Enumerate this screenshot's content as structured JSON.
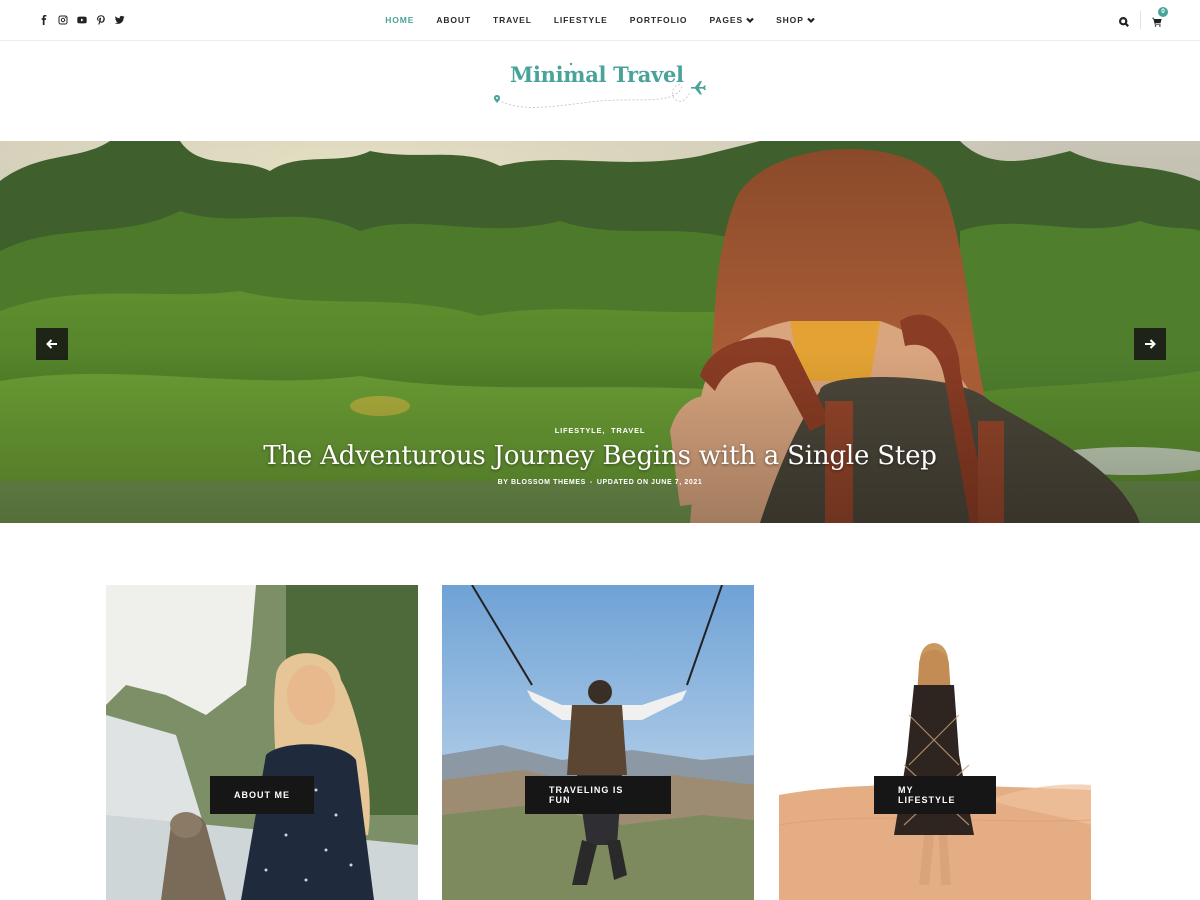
{
  "social": {
    "icons": [
      "facebook-icon",
      "instagram-icon",
      "youtube-icon",
      "pinterest-icon",
      "twitter-icon"
    ]
  },
  "nav": {
    "items": [
      {
        "label": "HOME",
        "active": true
      },
      {
        "label": "ABOUT"
      },
      {
        "label": "TRAVEL"
      },
      {
        "label": "LIFESTYLE"
      },
      {
        "label": "PORTFOLIO"
      },
      {
        "label": "PAGES",
        "dropdown": true
      },
      {
        "label": "SHOP",
        "dropdown": true
      }
    ]
  },
  "tools": {
    "search_icon": "search-icon",
    "cart_icon": "cart-icon",
    "cart_count": "0"
  },
  "logo": {
    "text": "Minimal Travel",
    "icons": [
      "location-pin-icon",
      "airplane-icon"
    ]
  },
  "hero": {
    "categories": [
      "LIFESTYLE",
      "TRAVEL"
    ],
    "category_separator": ",",
    "title": "The Adventurous Journey Begins with a Single Step",
    "meta": {
      "author": "BY BLOSSOM THEMES",
      "separator": "-",
      "updated": "UPDATED ON JUNE 7, 2021"
    },
    "prev_icon": "arrow-left-icon",
    "next_icon": "arrow-right-icon"
  },
  "cards": [
    {
      "label": "ABOUT ME"
    },
    {
      "label": "TRAVELING IS FUN"
    },
    {
      "label": "MY LIFESTYLE"
    }
  ],
  "colors": {
    "accent": "#4aa39b",
    "button_bg": "#161616",
    "text": "#2b2b2b"
  }
}
